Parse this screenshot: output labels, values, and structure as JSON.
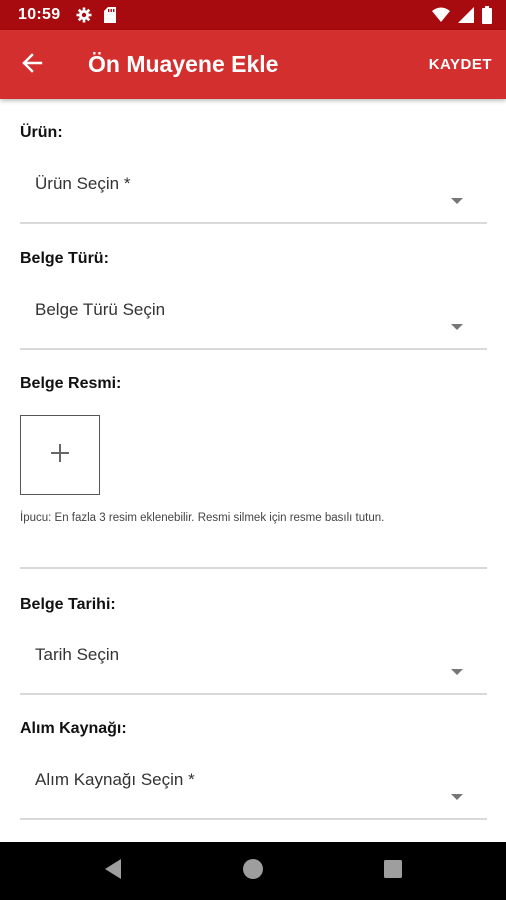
{
  "status_bar": {
    "time": "10:59",
    "left_icons": [
      "gear-icon",
      "sd-card-icon"
    ],
    "right_icons": [
      "wifi-icon",
      "signal-icon",
      "battery-icon"
    ]
  },
  "app_bar": {
    "title": "Ön Muayene Ekle",
    "save_label": "KAYDET",
    "back_icon": "arrow-left-icon"
  },
  "form": {
    "product": {
      "label": "Ürün:",
      "placeholder": "Ürün Seçin *"
    },
    "document_type": {
      "label": "Belge Türü:",
      "placeholder": "Belge Türü Seçin"
    },
    "document_image": {
      "label": "Belge Resmi:",
      "add_icon": "plus-icon",
      "hint": "İpucu: En fazla 3 resim eklenebilir. Resmi silmek için resme basılı tutun."
    },
    "document_date": {
      "label": "Belge Tarihi:",
      "placeholder": "Tarih Seçin"
    },
    "purchase_source": {
      "label": "Alım Kaynağı:",
      "placeholder": "Alım Kaynağı Seçin *"
    }
  },
  "colors": {
    "status_bar": "#a80b0f",
    "app_bar": "#d32f2f",
    "nav_bar": "#000000",
    "divider": "#d9d9d9"
  },
  "nav_bar": {
    "buttons": [
      "back-triangle-icon",
      "home-circle-icon",
      "recents-square-icon"
    ]
  }
}
